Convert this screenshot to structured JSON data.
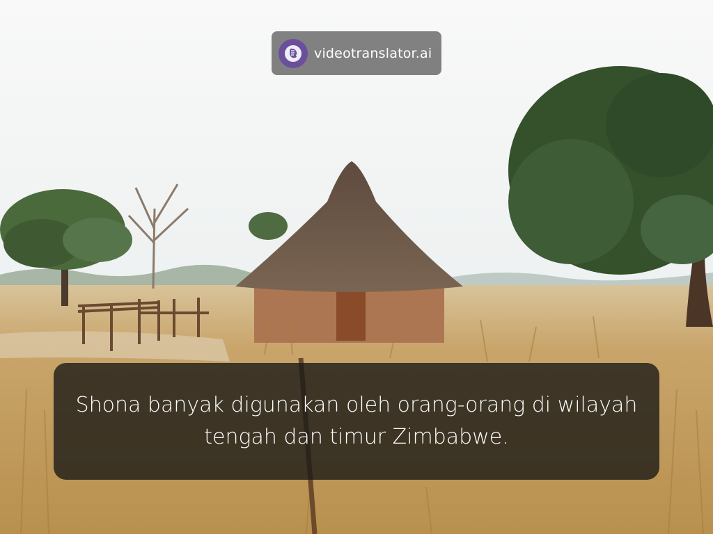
{
  "brand": {
    "name": "videotranslator.ai",
    "logo_icon": "face-profile-icon",
    "logo_color": "#6c4f9c"
  },
  "subtitle": {
    "text": "Shona banyak digunakan oleh orang-orang di wilayah\ntengah dan timur Zimbabwe."
  },
  "scene": {
    "description_icon": "thatched-hut-photo",
    "sky_color": "#f4f6f5",
    "grass_color": "#c9a366",
    "roof_color": "#6f5a4a",
    "wall_color": "#b07a55",
    "tree_color": "#3f5a32"
  }
}
